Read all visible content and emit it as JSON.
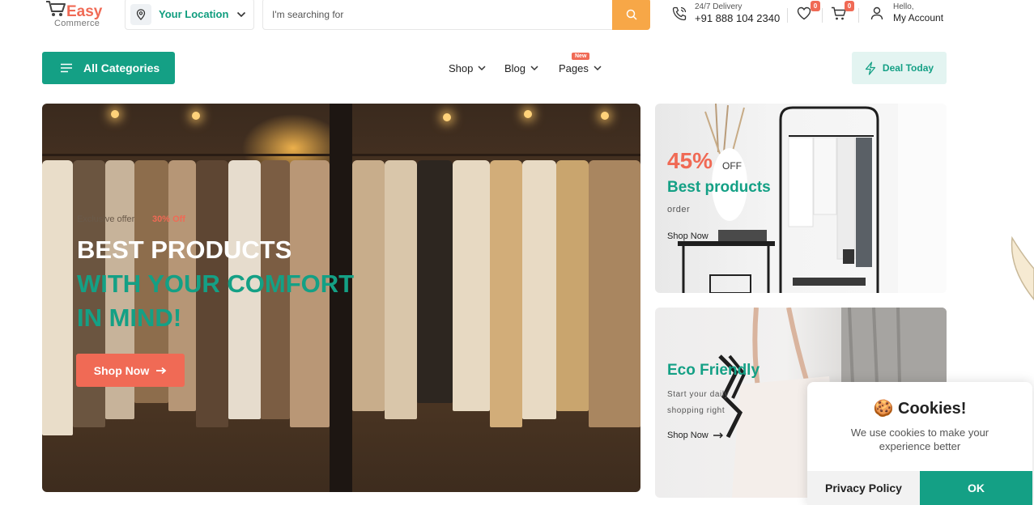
{
  "header": {
    "logo_main": "Easy",
    "logo_sub": "Commerce",
    "location_label": "Your Location",
    "search_placeholder": "I'm searching for",
    "delivery_label": "24/7 Delivery",
    "delivery_phone": "+91 888 104 2340",
    "wishlist_count": "0",
    "cart_count": "0",
    "account_greeting": "Hello,",
    "account_label": "My Account"
  },
  "nav": {
    "all_categories": "All Categories",
    "items": [
      {
        "label": "Shop"
      },
      {
        "label": "Blog"
      },
      {
        "label": "Pages",
        "badge": "New"
      }
    ],
    "deal_label": "Deal Today"
  },
  "hero": {
    "tag": "Exclusive offer",
    "discount": "30% Off",
    "line1": "BEST PRODUCTS",
    "line2": "WITH YOUR COMFORT",
    "line3": "IN MIND!",
    "button": "Shop Now"
  },
  "promo1": {
    "percent": "45%",
    "off": "OFF",
    "title": "Best products",
    "subtitle": "order",
    "link": "Shop Now"
  },
  "promo2": {
    "title": "Eco Friendly",
    "subtitle": "Start your daily shopping right",
    "link": "Shop Now"
  },
  "cookie": {
    "emoji": "🍪",
    "title": "Cookies!",
    "text": "We use cookies to make your experience better",
    "policy_button": "Privacy Policy",
    "ok_button": "OK"
  },
  "colors": {
    "brand_green": "#14a085",
    "accent_coral": "#f06a55",
    "search_orange": "#f7a747"
  }
}
